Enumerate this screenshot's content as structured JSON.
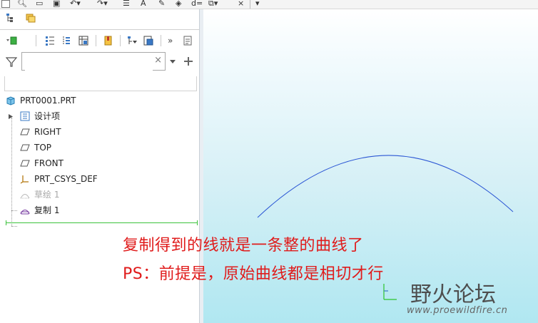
{
  "search": {
    "value": "",
    "clear_symbol": "×"
  },
  "tree": {
    "root": "PRT0001.PRT",
    "items": [
      {
        "label": "设计项"
      },
      {
        "label": "RIGHT"
      },
      {
        "label": "TOP"
      },
      {
        "label": "FRONT"
      },
      {
        "label": "PRT_CSYS_DEF"
      },
      {
        "label": "草绘 1"
      },
      {
        "label": "复制 1"
      }
    ]
  },
  "toolbar": {
    "setup_text": "d=",
    "close_symbol": "×"
  },
  "overlay": {
    "line1": "复制得到的线就是一条整的曲线了",
    "line2": "PS：前提是，原始曲线都是相切才行"
  },
  "watermark": {
    "brand": "野火论坛",
    "url": "www.proewildfire.cn"
  },
  "colors": {
    "accent_red": "#e01b1b",
    "curve_blue": "#2a55d4",
    "tree_green": "#3cc23c"
  }
}
